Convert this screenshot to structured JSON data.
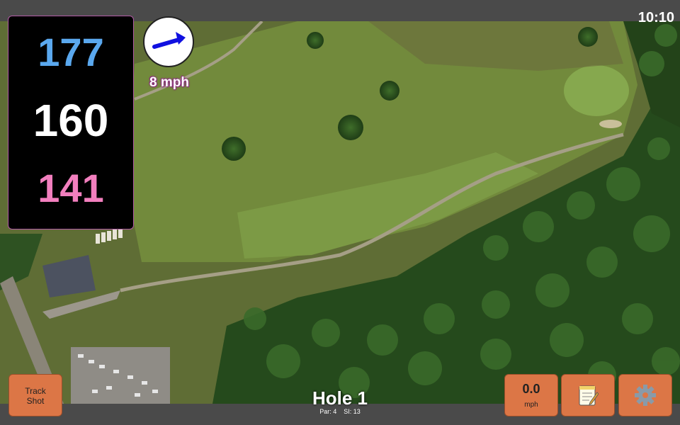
{
  "clock": "10:10",
  "yardage": {
    "back": "177",
    "middle": "160",
    "front": "141"
  },
  "wind": {
    "speed_label": "8 mph",
    "icon": "arrow-icon",
    "direction": "north-east"
  },
  "track_shot": {
    "line1": "Track",
    "line2": "Shot"
  },
  "speed": {
    "value": "0.0",
    "unit": "mph"
  },
  "notes": {
    "icon": "notepad-icon"
  },
  "settings": {
    "icon": "gear-icon"
  },
  "hole": {
    "title": "Hole 1",
    "par_label": "Par: 4",
    "si_label": "SI: 13"
  },
  "colors": {
    "back": "#5aa8ee",
    "middle": "#ffffff",
    "front": "#f27fbe",
    "button": "#dc7646",
    "accent": "#b25aa6"
  }
}
